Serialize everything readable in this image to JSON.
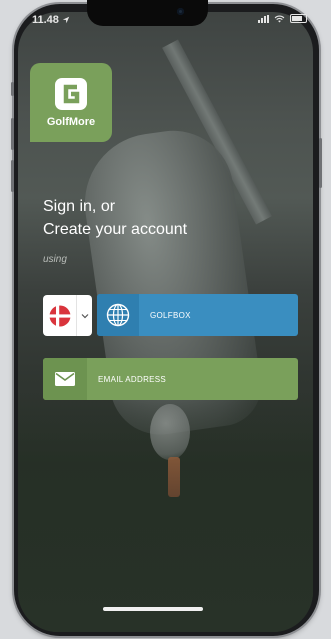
{
  "status_bar": {
    "time": "11.48",
    "location_icon": "location-arrow-icon",
    "signal_icon": "cellular-signal-icon",
    "wifi_icon": "wifi-icon",
    "battery_icon": "battery-icon"
  },
  "logo": {
    "name": "GolfMore",
    "icon": "golfmore-g-icon"
  },
  "heading": {
    "line1": "Sign in, or",
    "line2": "Create your account"
  },
  "subheading": "using",
  "country_selector": {
    "flag_icon": "denmark-flag-icon",
    "chevron_icon": "chevron-down-icon"
  },
  "golfbox_button": {
    "label": "GOLFBOX",
    "icon": "globe-icon",
    "color": "#3a8ec0"
  },
  "email_button": {
    "label": "EMAIL ADDRESS",
    "icon": "envelope-icon",
    "color": "#7aa05b"
  },
  "colors": {
    "brand_green": "#7aa05b",
    "golfbox_blue": "#3a8ec0",
    "text_white": "#ffffff"
  }
}
